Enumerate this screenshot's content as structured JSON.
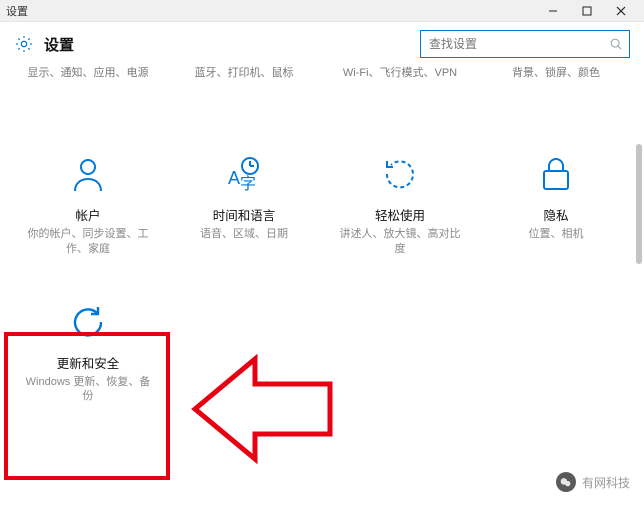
{
  "window": {
    "title": "设置"
  },
  "header": {
    "title": "设置",
    "search_placeholder": "查找设置"
  },
  "toprow": [
    {
      "sub": "显示、通知、应用、电源"
    },
    {
      "sub": "蓝牙、打印机、鼠标"
    },
    {
      "sub": "Wi-Fi、飞行模式、VPN"
    },
    {
      "sub": "背景、锁屏、颜色"
    }
  ],
  "categories": {
    "accounts": {
      "title": "帐户",
      "sub": "你的帐户、同步设置、工作、家庭"
    },
    "timelang": {
      "title": "时间和语言",
      "sub": "语音、区域、日期"
    },
    "ease": {
      "title": "轻松使用",
      "sub": "讲述人、放大镜、高对比度"
    },
    "privacy": {
      "title": "隐私",
      "sub": "位置、相机"
    },
    "update": {
      "title": "更新和安全",
      "sub": "Windows 更新、恢复、备份"
    }
  },
  "watermark": {
    "text": "有网科技"
  }
}
